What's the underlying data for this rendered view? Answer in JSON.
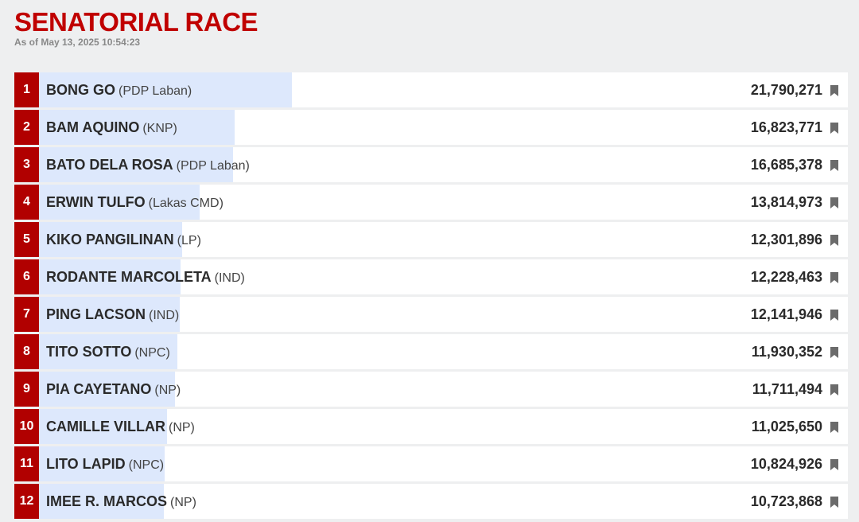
{
  "header": {
    "title": "SENATORIAL RACE",
    "timestamp": "As of May 13, 2025 10:54:23"
  },
  "colors": {
    "accent": "#b10000",
    "bar": "#dde8fc",
    "background": "#eeeff0"
  },
  "max_votes": 21790271,
  "candidates": [
    {
      "rank": "1",
      "name": "BONG GO",
      "party": "(PDP Laban)",
      "votes": "21,790,271",
      "vote_count": 21790271
    },
    {
      "rank": "2",
      "name": "BAM AQUINO",
      "party": "(KNP)",
      "votes": "16,823,771",
      "vote_count": 16823771
    },
    {
      "rank": "3",
      "name": "BATO DELA ROSA",
      "party": "(PDP Laban)",
      "votes": "16,685,378",
      "vote_count": 16685378
    },
    {
      "rank": "4",
      "name": "ERWIN TULFO",
      "party": "(Lakas CMD)",
      "votes": "13,814,973",
      "vote_count": 13814973
    },
    {
      "rank": "5",
      "name": "KIKO PANGILINAN",
      "party": "(LP)",
      "votes": "12,301,896",
      "vote_count": 12301896
    },
    {
      "rank": "6",
      "name": "RODANTE MARCOLETA",
      "party": "(IND)",
      "votes": "12,228,463",
      "vote_count": 12228463
    },
    {
      "rank": "7",
      "name": "PING LACSON",
      "party": "(IND)",
      "votes": "12,141,946",
      "vote_count": 12141946
    },
    {
      "rank": "8",
      "name": "TITO SOTTO",
      "party": "(NPC)",
      "votes": "11,930,352",
      "vote_count": 11930352
    },
    {
      "rank": "9",
      "name": "PIA CAYETANO",
      "party": "(NP)",
      "votes": "11,711,494",
      "vote_count": 11711494
    },
    {
      "rank": "10",
      "name": "CAMILLE VILLAR",
      "party": "(NP)",
      "votes": "11,025,650",
      "vote_count": 11025650
    },
    {
      "rank": "11",
      "name": "LITO LAPID",
      "party": "(NPC)",
      "votes": "10,824,926",
      "vote_count": 10824926
    },
    {
      "rank": "12",
      "name": "IMEE R. MARCOS",
      "party": "(NP)",
      "votes": "10,723,868",
      "vote_count": 10723868
    }
  ]
}
